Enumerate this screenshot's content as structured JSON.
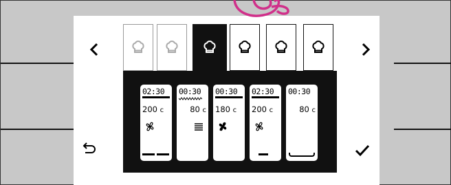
{
  "display": {
    "accent_color": "#d0308a",
    "background_color": "#c8c8c8",
    "screen_color": "#ffffff",
    "panel_color": "#111111"
  },
  "nav": {
    "prev_icon": "chevron-left-icon",
    "next_icon": "chevron-right-icon",
    "back_icon": "back-arrow-icon",
    "confirm_icon": "checkmark-icon"
  },
  "mode_tabs": [
    {
      "icon": "chef-hat-icon",
      "state": "disabled"
    },
    {
      "icon": "chef-hat-icon",
      "state": "disabled"
    },
    {
      "icon": "chef-hat-icon",
      "state": "selected"
    },
    {
      "icon": "chef-hat-icon",
      "state": "normal"
    },
    {
      "icon": "chef-hat-icon",
      "state": "normal"
    },
    {
      "icon": "chef-hat-icon",
      "state": "normal"
    }
  ],
  "steps": [
    {
      "time": "02:30",
      "temp": "200",
      "unit": "c",
      "icon": "fan-icon",
      "indicator": "bars"
    },
    {
      "time": "00:30",
      "temp": "80",
      "unit": "c",
      "icon": "grill-icon",
      "indicator": "wave"
    },
    {
      "time": "00:30",
      "temp": "180",
      "unit": "c",
      "icon": "fan-icon",
      "indicator": "none"
    },
    {
      "time": "02:30",
      "temp": "200",
      "unit": "c",
      "icon": "fan-icon",
      "indicator": "bottom-bar"
    },
    {
      "time": "00:30",
      "temp": "80",
      "unit": "c",
      "icon": "none",
      "indicator": "tray"
    }
  ],
  "gesture": {
    "icon": "hand-touch-icon"
  }
}
